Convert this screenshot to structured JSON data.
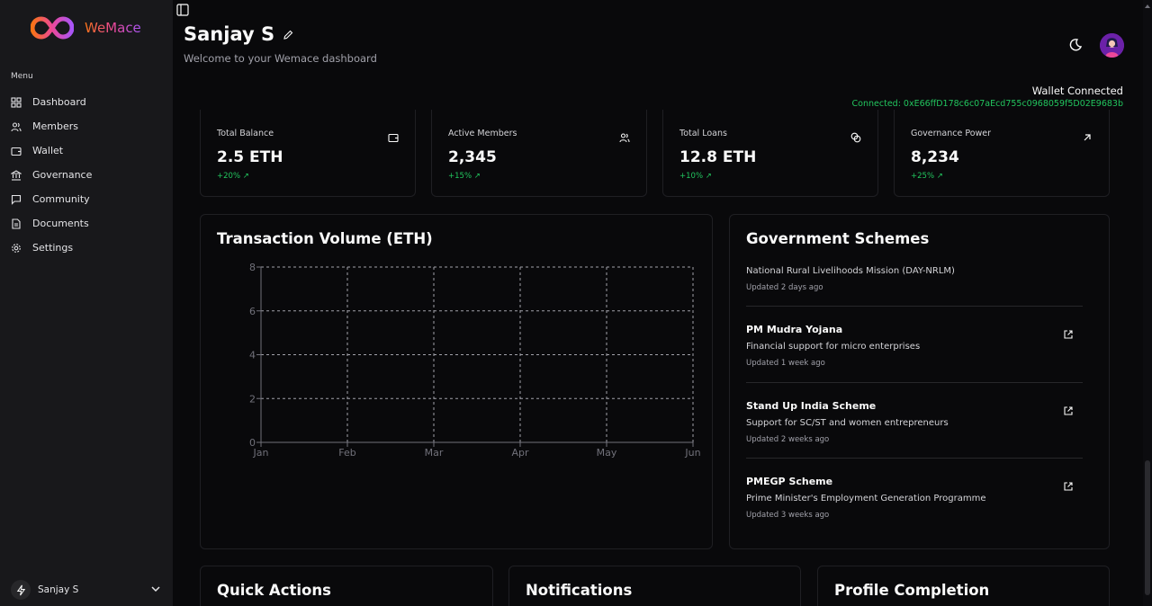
{
  "brand": {
    "name": "WeMace"
  },
  "sidebar": {
    "menu_label": "Menu",
    "items": [
      {
        "label": "Dashboard",
        "icon": "grid-icon"
      },
      {
        "label": "Members",
        "icon": "users-icon"
      },
      {
        "label": "Wallet",
        "icon": "wallet-icon"
      },
      {
        "label": "Governance",
        "icon": "landmark-icon"
      },
      {
        "label": "Community",
        "icon": "message-icon"
      },
      {
        "label": "Documents",
        "icon": "file-icon"
      },
      {
        "label": "Settings",
        "icon": "gear-icon"
      }
    ],
    "user": {
      "name": "Sanjay S"
    }
  },
  "header": {
    "title": "Sanjay S",
    "subtitle": "Welcome to your Wemace dashboard",
    "wallet_status": "Wallet Connected",
    "wallet_address": "Connected: 0xE66ffD178c6c07aEcd755c0968059f5D02E9683b"
  },
  "stats": [
    {
      "label": "Total Balance",
      "value": "2.5 ETH",
      "change": "+20% ↗",
      "icon": "wallet-icon"
    },
    {
      "label": "Active Members",
      "value": "2,345",
      "change": "+15% ↗",
      "icon": "users-icon"
    },
    {
      "label": "Total Loans",
      "value": "12.8 ETH",
      "change": "+10% ↗",
      "icon": "coins-icon"
    },
    {
      "label": "Governance Power",
      "value": "8,234",
      "change": "+25% ↗",
      "icon": "arrow-up-right-icon"
    }
  ],
  "transaction_panel": {
    "title": "Transaction Volume (ETH)"
  },
  "chart_data": {
    "type": "line",
    "title": "Transaction Volume (ETH)",
    "categories": [
      "Jan",
      "Feb",
      "Mar",
      "Apr",
      "May",
      "Jun"
    ],
    "series": [],
    "yticks": [
      "0",
      "2",
      "4",
      "6",
      "8"
    ],
    "ylim": [
      0,
      8
    ],
    "grid": true
  },
  "schemes_panel": {
    "title": "Government Schemes",
    "items": [
      {
        "name": "",
        "desc": "National Rural Livelihoods Mission (DAY-NRLM)",
        "updated": "Updated 2 days ago"
      },
      {
        "name": "PM Mudra Yojana",
        "desc": "Financial support for micro enterprises",
        "updated": "Updated 1 week ago"
      },
      {
        "name": "Stand Up India Scheme",
        "desc": "Support for SC/ST and women entrepreneurs",
        "updated": "Updated 2 weeks ago"
      },
      {
        "name": "PMEGP Scheme",
        "desc": "Prime Minister's Employment Generation Programme",
        "updated": "Updated 3 weeks ago"
      }
    ]
  },
  "bottom_panels": {
    "quick_actions": "Quick Actions",
    "notifications": "Notifications",
    "profile_completion": "Profile Completion"
  },
  "colors": {
    "accent_green": "#22c55e",
    "background": "#09090b",
    "sidebar": "#18181b"
  }
}
